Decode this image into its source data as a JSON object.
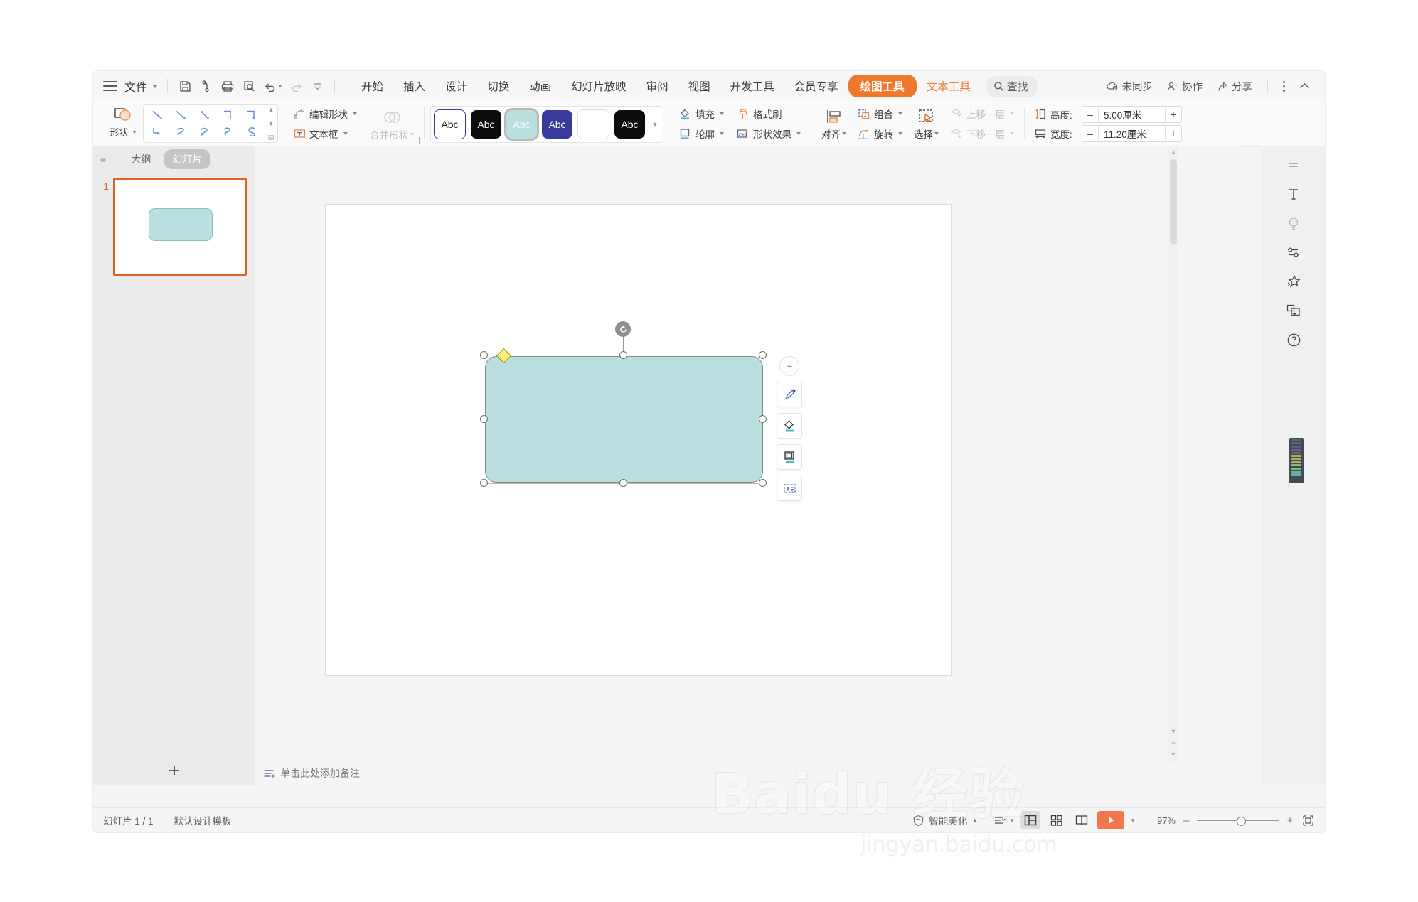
{
  "app": {
    "file_menu": "文件",
    "quick_access": [
      {
        "name": "save-icon",
        "label": "保存"
      },
      {
        "name": "cloud-save-icon",
        "label": "云保存"
      },
      {
        "name": "print-icon",
        "label": "打印"
      },
      {
        "name": "print-preview-icon",
        "label": "打印预览"
      },
      {
        "name": "undo-icon",
        "label": "撤销"
      },
      {
        "name": "redo-icon",
        "label": "恢复"
      },
      {
        "name": "more-commands-icon",
        "label": "更多"
      }
    ],
    "tabs": [
      {
        "label": "开始",
        "state": "normal"
      },
      {
        "label": "插入",
        "state": "normal"
      },
      {
        "label": "设计",
        "state": "normal"
      },
      {
        "label": "切换",
        "state": "normal"
      },
      {
        "label": "动画",
        "state": "normal"
      },
      {
        "label": "幻灯片放映",
        "state": "normal"
      },
      {
        "label": "审阅",
        "state": "normal"
      },
      {
        "label": "视图",
        "state": "normal"
      },
      {
        "label": "开发工具",
        "state": "normal"
      },
      {
        "label": "会员专享",
        "state": "normal"
      },
      {
        "label": "绘图工具",
        "state": "contextual-active"
      },
      {
        "label": "文本工具",
        "state": "contextual"
      }
    ],
    "search_label": "查找",
    "right_actions": [
      {
        "label": "未同步",
        "icon": "cloud-sync-icon"
      },
      {
        "label": "协作",
        "icon": "collaborate-icon"
      },
      {
        "label": "分享",
        "icon": "share-icon"
      }
    ],
    "collapse_ribbon_label": "折叠功能区"
  },
  "ribbon": {
    "shape_button": "形状",
    "shape_gallery_items": [
      "line",
      "arrow-line",
      "double-arrow-line",
      "elbow-connector",
      "elbow-arrow",
      "elbow-arrow-2",
      "curve-arrow",
      "curve-arrow-2",
      "curve-arrow-3",
      "s-curve"
    ],
    "edit_shape": "编辑形状",
    "text_box": "文本框",
    "merge_shapes": "合并形状",
    "styles": [
      {
        "label": "Abc",
        "bg": "#ffffff",
        "fg": "#1a1a1a",
        "border": "#3b3b9e",
        "selected": false
      },
      {
        "label": "Abc",
        "bg": "#0b0b0b",
        "fg": "#ffffff",
        "border": "#0b0b0b",
        "selected": false
      },
      {
        "label": "Abc",
        "bg": "#b9dfdf",
        "fg": "#ffffff",
        "border": "#b9dfdf",
        "selected": true
      },
      {
        "label": "Abc",
        "bg": "#383a9c",
        "fg": "#ffffff",
        "border": "#383a9c",
        "selected": false
      },
      {
        "label": "",
        "bg": "#ffffff",
        "fg": "#ffffff",
        "border": "#dcdcdc",
        "selected": false
      },
      {
        "label": "Abc",
        "bg": "#0b0b0b",
        "fg": "#ffffff",
        "border": "#0b0b0b",
        "selected": false
      }
    ],
    "fill": "填充",
    "format_painter": "格式刷",
    "outline": "轮廓",
    "shape_effects": "形状效果",
    "align": "对齐",
    "group": "组合",
    "rotate": "旋转",
    "select": "选择",
    "bring_forward": "上移一层",
    "send_backward": "下移一层",
    "height_label": "高度:",
    "height_value": "5.00厘米",
    "width_label": "宽度:",
    "width_value": "11.20厘米",
    "minus": "–",
    "plus": "+"
  },
  "left_pane": {
    "collapse": "«",
    "tabs": [
      {
        "label": "大纲",
        "active": false
      },
      {
        "label": "幻灯片",
        "active": true
      }
    ],
    "slides": [
      {
        "number": "1",
        "selected": true
      }
    ],
    "add_slide": "+"
  },
  "canvas": {
    "shape": {
      "fill_color": "#b9dfdf",
      "outline_color": "#8a8a8a",
      "name": "rounded-rectangle"
    },
    "float_toolbar": [
      {
        "name": "collapse-toolbar-icon",
        "label": "收起"
      },
      {
        "name": "format-painter-icon",
        "label": "格式刷"
      },
      {
        "name": "fill-color-icon",
        "label": "填充"
      },
      {
        "name": "outline-color-icon",
        "label": "轮廓"
      },
      {
        "name": "edit-text-icon",
        "label": "编辑文字"
      }
    ]
  },
  "notes": {
    "placeholder": "单击此处添加备注"
  },
  "right_bar": {
    "items": [
      {
        "name": "panel-lines-icon",
        "label": "功能面板"
      },
      {
        "name": "text-tool-icon",
        "label": "文本"
      },
      {
        "name": "idea-bulb-icon",
        "label": "灵感"
      },
      {
        "name": "settings-sliders-icon",
        "label": "属性"
      },
      {
        "name": "beautify-star-icon",
        "label": "美化"
      },
      {
        "name": "replace-image-icon",
        "label": "替换"
      },
      {
        "name": "help-icon",
        "label": "帮助"
      }
    ]
  },
  "status_bar": {
    "slide_count": "幻灯片 1 / 1",
    "template": "默认设计模板",
    "beautify": "智能美化",
    "views": [
      {
        "name": "view-options-icon",
        "label": "视图选项",
        "active": false
      },
      {
        "name": "normal-view-icon",
        "label": "普通视图",
        "active": true
      },
      {
        "name": "slide-sorter-icon",
        "label": "幻灯片浏览",
        "active": false
      },
      {
        "name": "reading-view-icon",
        "label": "阅读视图",
        "active": false
      }
    ],
    "play_label": "放映",
    "zoom_value": "97%",
    "zoom_out": "–",
    "zoom_in": "+",
    "fit_label": "适应窗口"
  },
  "watermark": {
    "main": "Baidu 经验",
    "sub": "jingyan.baidu.com"
  },
  "colors": {
    "accent": "#f0782d",
    "contextual_text": "#ef7a3b",
    "shape_fill": "#b9dfdf",
    "play_button": "#f4764e",
    "slide_border": "#e0601f"
  }
}
